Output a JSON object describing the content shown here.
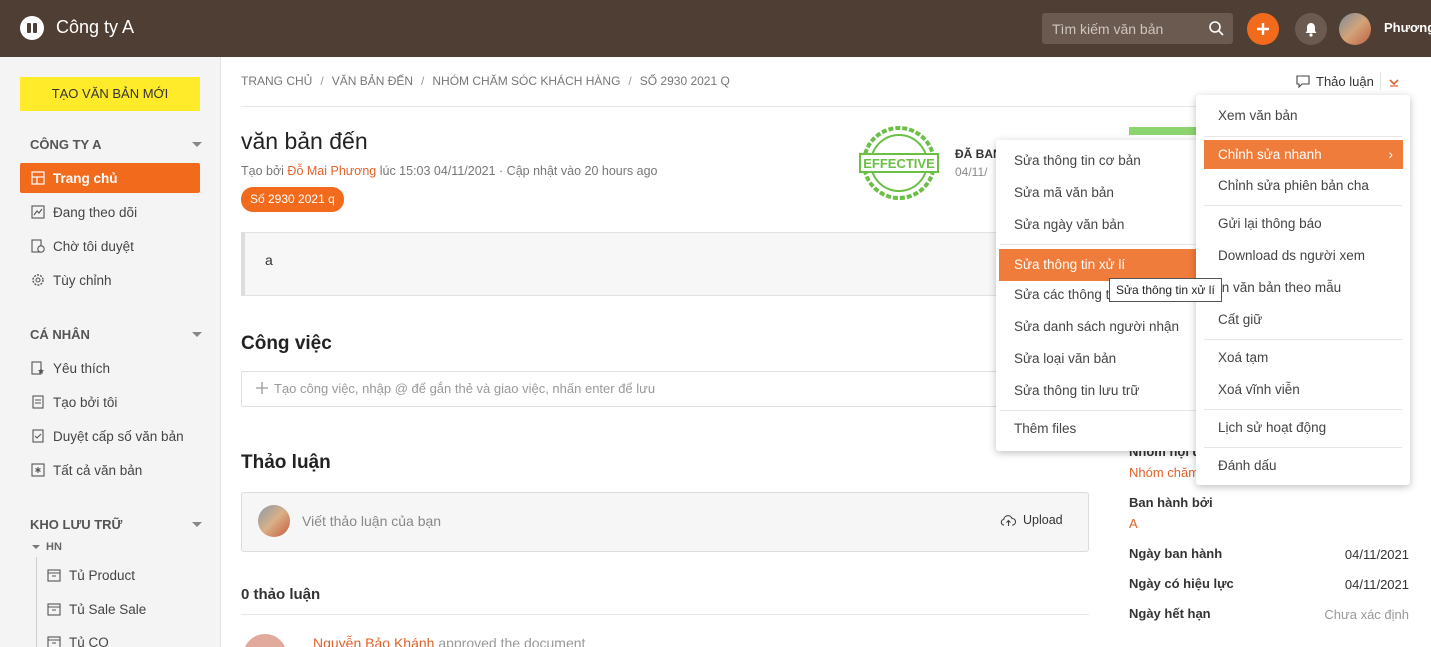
{
  "header": {
    "company": "Công ty A",
    "search_placeholder": "Tìm kiếm văn bản",
    "user_name": "Phương"
  },
  "sidebar": {
    "new_button": "TẠO VĂN BẢN MỚI",
    "section_company": "CÔNG TY A",
    "company_items": [
      "Trang chủ",
      "Đang theo dõi",
      "Chờ tôi duyệt",
      "Tùy chỉnh"
    ],
    "section_personal": "CÁ NHÂN",
    "personal_items": [
      "Yêu thích",
      "Tạo bởi tôi",
      "Duyệt cấp số văn bản",
      "Tất cả văn bản"
    ],
    "section_storage": "KHO LƯU TRỮ",
    "storage_group": "HN",
    "storage_items": [
      "Tủ Product",
      "Tủ Sale Sale",
      "Tủ CO"
    ]
  },
  "breadcrumb": [
    "TRANG CHỦ",
    "VĂN BẢN ĐẾN",
    "NHÓM CHĂM SÓC KHÁCH HÀNG",
    "SỐ 2930 2021 Q"
  ],
  "discuss_link": "Thảo luận",
  "document": {
    "title": "văn bản đến",
    "meta_prefix": "Tạo bởi ",
    "author": "Đỗ Mai Phương",
    "meta_suffix": " lúc 15:03 04/11/2021 · Cập nhật vào 20 hours ago",
    "tag": "Số 2930 2021 q",
    "stamp_text": "EFFECTIVE",
    "status": "ĐÃ BAN",
    "status_date": "04/11/",
    "content": "a"
  },
  "tasks": {
    "heading": "Công việc",
    "placeholder": "Tạo công việc, nhập @ để gắn thẻ và giao việc, nhấn enter để lưu"
  },
  "discussion": {
    "heading": "Thảo luận",
    "placeholder": "Viết thảo luận của bạn",
    "upload": "Upload",
    "count": "0 thảo luận",
    "activity_user": "Nguyễn Bảo Khánh",
    "activity_text": " approved the document"
  },
  "right_panel": {
    "group_label": "Nhóm nội d",
    "group_value": "Nhóm chăm",
    "issued_by_label": "Ban hành bởi",
    "issued_by_value": "A",
    "issue_date_label": "Ngày ban hành",
    "issue_date": "04/11/2021",
    "effective_label": "Ngày có hiệu lực",
    "effective_date": "04/11/2021",
    "expiry_label": "Ngày hết hạn",
    "expiry_value": "Chưa xác định"
  },
  "main_menu": {
    "items": [
      "Xem văn bản",
      "Chỉnh sửa nhanh",
      "Chỉnh sửa phiên bản cha",
      "Gửi lại thông báo",
      "Download ds người xem",
      "In văn bản theo mẫu",
      "Cất giữ",
      "Xoá tạm",
      "Xoá vĩnh viễn",
      "Lịch sử hoạt động",
      "Đánh dấu"
    ]
  },
  "submenu": {
    "items": [
      "Sửa thông tin cơ bản",
      "Sửa mã văn bản",
      "Sửa ngày văn bản",
      "Sửa thông tin xử lí",
      "Sửa các thông tin",
      "Sửa danh sách người nhận",
      "Sửa loại văn bản",
      "Sửa thông tin lưu trữ",
      "Thêm files"
    ]
  },
  "tooltip": "Sửa thông tin xử lí",
  "colors": {
    "accent": "#f26b1d",
    "topbar": "#4f3e33",
    "new_button": "#ffeb2a",
    "menu_highlight": "#f07c3c"
  }
}
